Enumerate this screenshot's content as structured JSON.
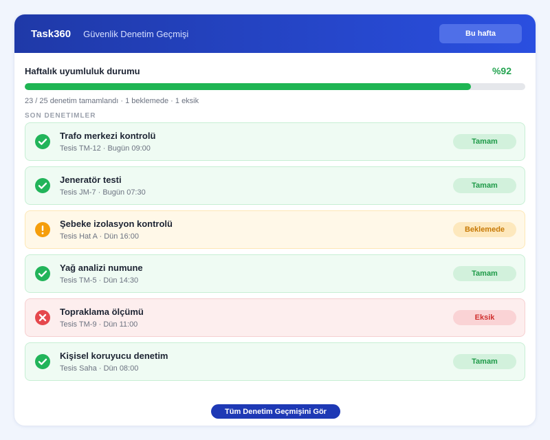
{
  "header": {
    "brand": "Task360",
    "subtitle": "Güvenlik Denetim Geçmişi",
    "week_button": "Bu hafta",
    "colors": {
      "gradient_start": "#1f39a8",
      "gradient_end": "#2a4fe0"
    }
  },
  "progress": {
    "title": "Haftalık uyumluluk durumu",
    "percent_label": "%92",
    "percent_value": 0.92,
    "meta": "23 / 25 denetim tamamlandı · 1 beklemede · 1 eksik",
    "color": "#1fb553"
  },
  "section": {
    "label": "SON DENETIMLER"
  },
  "items": [
    {
      "status": "ok",
      "icon": "check-circle-icon",
      "title": "Trafo merkezi kontrolü",
      "sub": "Tesis TM-12 · Bugün 09:00",
      "badge": "Tamam"
    },
    {
      "status": "ok",
      "icon": "check-circle-icon",
      "title": "Jeneratör testi",
      "sub": "Tesis JM-7 · Bugün 07:30",
      "badge": "Tamam"
    },
    {
      "status": "wait",
      "icon": "warning-circle-icon",
      "title": "Şebeke izolasyon kontrolü",
      "sub": "Tesis Hat A · Dün 16:00",
      "badge": "Beklemede"
    },
    {
      "status": "ok",
      "icon": "check-circle-icon",
      "title": "Yağ analizi numune",
      "sub": "Tesis TM-5 · Dün 14:30",
      "badge": "Tamam"
    },
    {
      "status": "miss",
      "icon": "x-circle-icon",
      "title": "Topraklama ölçümü",
      "sub": "Tesis TM-9 · Dün 11:00",
      "badge": "Eksik"
    },
    {
      "status": "ok",
      "icon": "check-circle-icon",
      "title": "Kişisel koruyucu denetim",
      "sub": "Tesis Saha · Dün 08:00",
      "badge": "Tamam"
    }
  ],
  "status_colors": {
    "ok": "#22b45a",
    "wait": "#f59e0b",
    "miss": "#e5484d"
  },
  "footer": {
    "button": "Tüm Denetim Geçmişini Gör"
  }
}
